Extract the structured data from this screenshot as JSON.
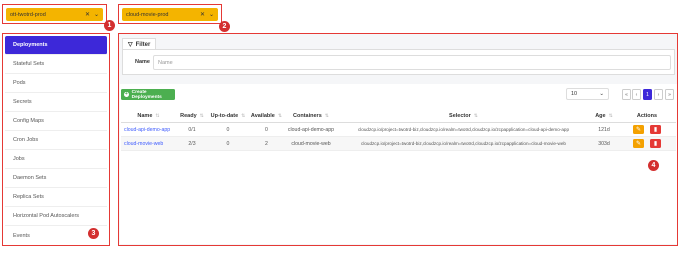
{
  "cluster_select": {
    "value": "ott-twotrd-prod",
    "badge": "1"
  },
  "app_select": {
    "value": "cloud-movie-prod",
    "badge": "2"
  },
  "sidebar": {
    "badge": "3",
    "items": [
      {
        "label": "Deployments"
      },
      {
        "label": "Stateful Sets"
      },
      {
        "label": "Pods"
      },
      {
        "label": "Secrets"
      },
      {
        "label": "Config Maps"
      },
      {
        "label": "Cron Jobs"
      },
      {
        "label": "Jobs"
      },
      {
        "label": "Daemon Sets"
      },
      {
        "label": "Replica Sets"
      },
      {
        "label": "Horizontal Pod Autoscalers"
      },
      {
        "label": "Events"
      }
    ]
  },
  "filter": {
    "tab_label": "Filter",
    "name_label": "Name",
    "name_placeholder": "Name"
  },
  "create_button": {
    "label": "Create Deployments"
  },
  "page_size": {
    "value": "10"
  },
  "pagination": {
    "current": "1",
    "first": "«",
    "prev": "‹",
    "next": "›",
    "last": "»"
  },
  "table": {
    "badge": "4",
    "columns": [
      "Name",
      "Ready",
      "Up-to-date",
      "Available",
      "Containers",
      "Selector",
      "Age",
      "Actions"
    ],
    "rows": [
      {
        "name": "cloud-api-demo-app",
        "ready": "0/1",
        "uptodate": "0",
        "available": "0",
        "containers": "cloud-api-demo-app",
        "selector": "cloudzcp.io/project=twotrd-biz,cloudzcp.io/realm=twotrd,cloudzcp.io/zcpapplication=cloud-api-demo-app",
        "age": "121d"
      },
      {
        "name": "cloud-movie-web",
        "ready": "2/3",
        "uptodate": "0",
        "available": "2",
        "containers": "cloud-movie-web",
        "selector": "cloudzcp.io/project=twotrd-biz,cloudzcp.io/realm=twotrd,cloudzcp.io/zcpapplication=cloud-movie-web",
        "age": "303d"
      }
    ]
  },
  "colors": {
    "accent": "#3d28d9",
    "warning": "#f4b400",
    "danger": "#e53935",
    "success": "#4caf50"
  }
}
